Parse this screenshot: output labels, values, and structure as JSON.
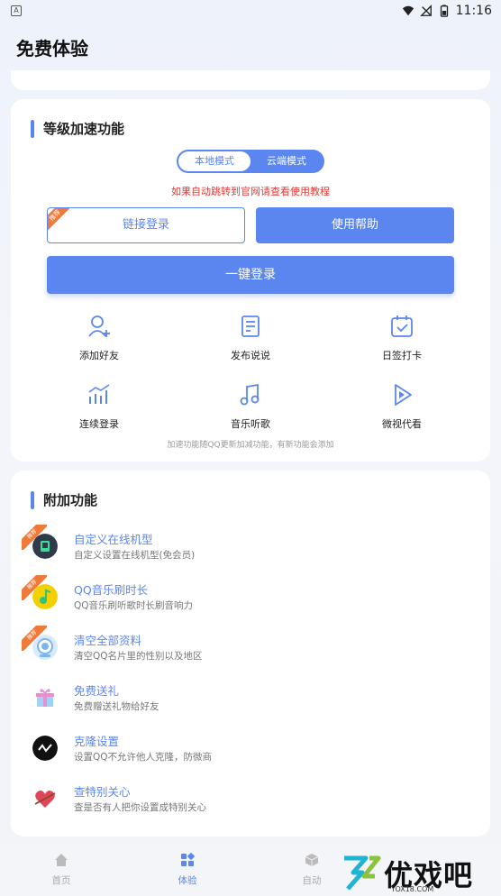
{
  "status_bar": {
    "time": "11:16",
    "left_glyph": "A"
  },
  "header": {
    "title": "免费体验"
  },
  "level_section": {
    "title": "等级加速功能",
    "modes": [
      "本地模式",
      "云端模式"
    ],
    "active_mode": 0,
    "warning": "如果自动跳转到官网请查看使用教程",
    "link_login_label": "链接登录",
    "link_login_badge": "推荐",
    "help_label": "使用帮助",
    "one_key_login_label": "一键登录",
    "features": [
      {
        "label": "添加好友",
        "icon": "add-friend-icon"
      },
      {
        "label": "发布说说",
        "icon": "post-icon"
      },
      {
        "label": "日签打卡",
        "icon": "calendar-check-icon"
      },
      {
        "label": "连续登录",
        "icon": "chart-icon"
      },
      {
        "label": "音乐听歌",
        "icon": "music-icon"
      },
      {
        "label": "微视代看",
        "icon": "play-icon"
      }
    ],
    "footnote": "加速功能随QQ更新加减功能，有新功能会添加"
  },
  "extra_section": {
    "title": "附加功能",
    "items": [
      {
        "title": "自定义在线机型",
        "desc": "自定义设置在线机型(免会员)",
        "badge": "推荐",
        "icon": "device-icon"
      },
      {
        "title": "QQ音乐刷时长",
        "desc": "QQ音乐刷听歌时长刷音响力",
        "badge": "推荐",
        "icon": "qq-music-icon"
      },
      {
        "title": "清空全部资料",
        "desc": "清空QQ名片里的性别以及地区",
        "badge": "推荐",
        "icon": "clear-profile-icon"
      },
      {
        "title": "免费送礼",
        "desc": "免费赠送礼物给好友",
        "badge": "",
        "icon": "gift-icon"
      },
      {
        "title": "克隆设置",
        "desc": "设置QQ不允许他人克隆，防微商",
        "badge": "",
        "icon": "clone-icon"
      },
      {
        "title": "查特别关心",
        "desc": "查是否有人把你设置成特别关心",
        "badge": "",
        "icon": "heart-icon"
      }
    ]
  },
  "tabs": [
    {
      "label": "首页",
      "icon": "home-icon"
    },
    {
      "label": "体验",
      "icon": "grid-icon"
    },
    {
      "label": "自动",
      "icon": "cube-icon"
    }
  ],
  "active_tab": 1,
  "watermark": {
    "text": "优戏吧",
    "url": "YOX18.COM"
  },
  "colors": {
    "accent": "#5b86f0",
    "warning": "#e53935",
    "badge": "#f07a3a"
  }
}
